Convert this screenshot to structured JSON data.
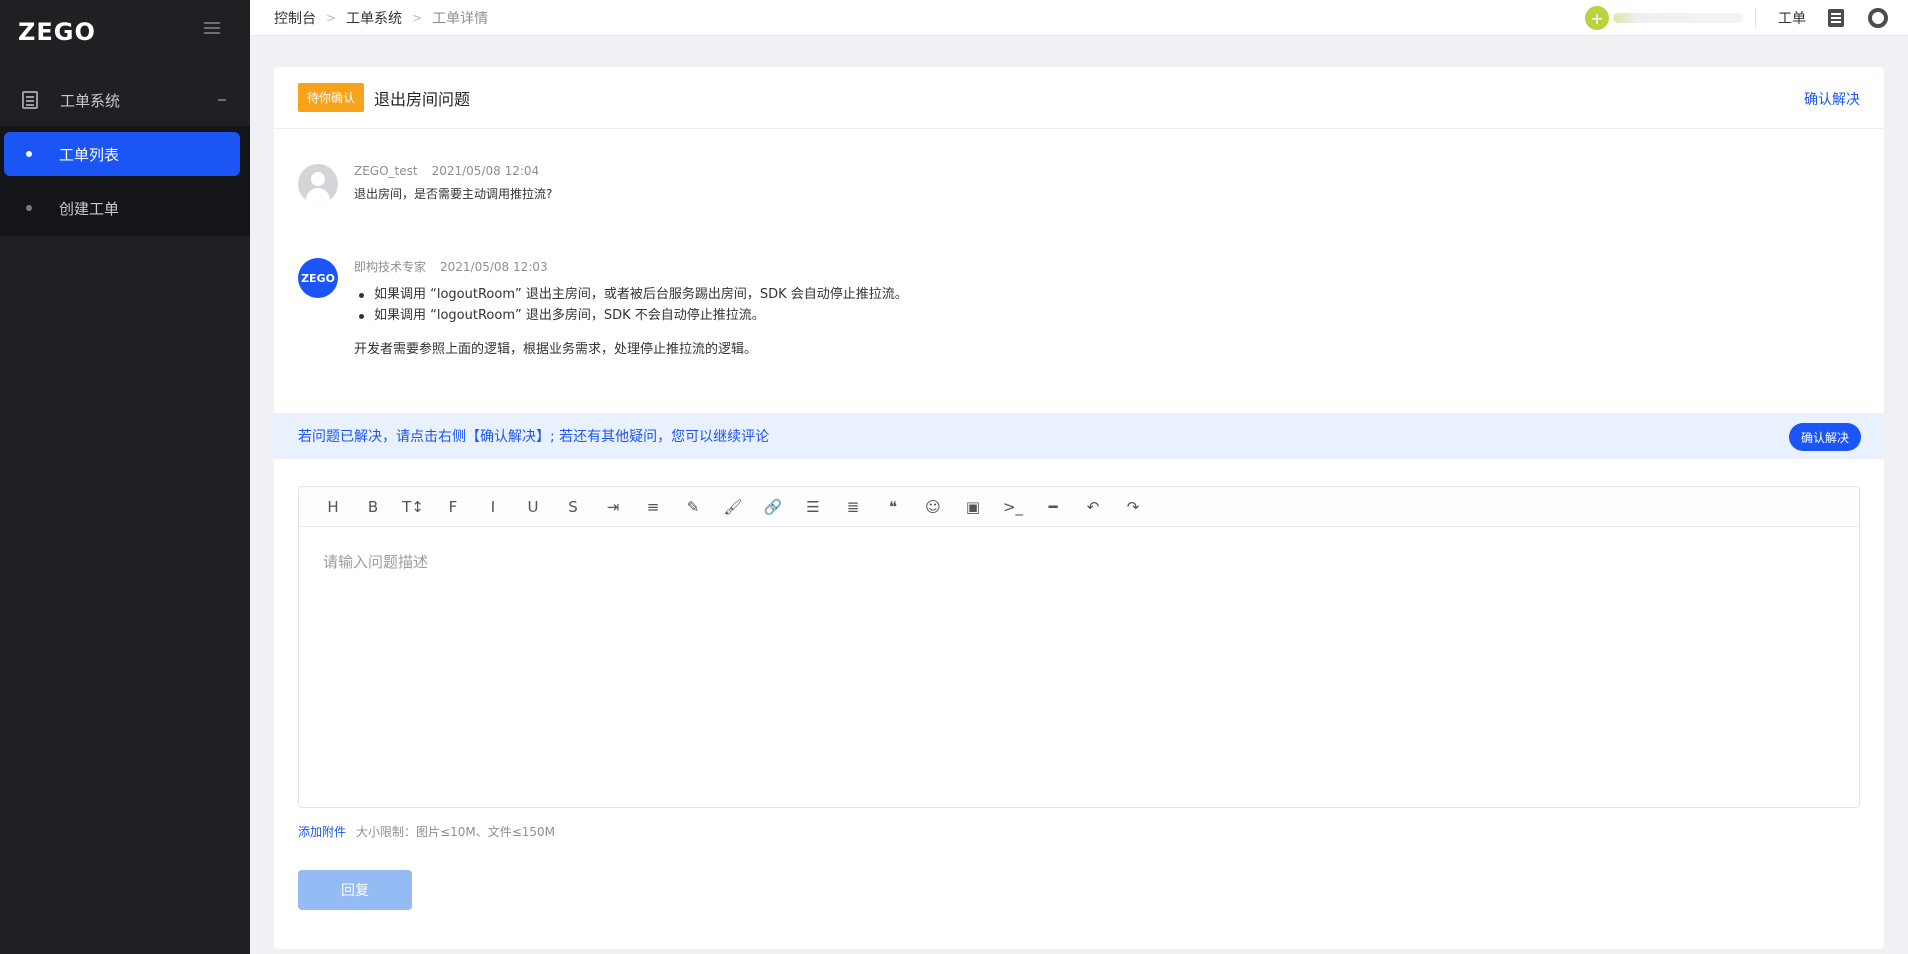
{
  "sidebar": {
    "logo": "ZEGO",
    "group_label": "工单系统",
    "items": [
      {
        "label": "工单列表",
        "active": true
      },
      {
        "label": "创建工单",
        "active": false
      }
    ]
  },
  "topbar": {
    "breadcrumbs": [
      "控制台",
      "工单系统",
      "工单详情"
    ],
    "link_ticket": "工单",
    "avatar_glyph": "+"
  },
  "ticket": {
    "status_badge": "待你确认",
    "title": "退出房间问题",
    "confirm_link": "确认解决"
  },
  "messages": [
    {
      "author": "ZEGO_test",
      "time": "2021/05/08 12:04",
      "text": "退出房间，是否需要主动调用推拉流?"
    },
    {
      "author": "即构技术专家",
      "avatar_text": "ZEGO",
      "time": "2021/05/08 12:03",
      "bullets": [
        "如果调用 “logoutRoom” 退出主房间，或者被后台服务踢出房间，SDK 会自动停止推拉流。",
        "如果调用 “logoutRoom” 退出多房间，SDK 不会自动停止推拉流。"
      ],
      "after": "开发者需要参照上面的逻辑，根据业务需求，处理停止推拉流的逻辑。"
    }
  ],
  "tip": {
    "text": "若问题已解决，请点击右侧【确认解决】; 若还有其他疑问，您可以继续评论",
    "button": "确认解决"
  },
  "editor": {
    "toolbar": [
      {
        "name": "heading-icon",
        "glyph": "H"
      },
      {
        "name": "bold-icon",
        "glyph": "B"
      },
      {
        "name": "font-size-icon",
        "glyph": "T↕"
      },
      {
        "name": "font-family-icon",
        "glyph": "F"
      },
      {
        "name": "italic-icon",
        "glyph": "I"
      },
      {
        "name": "underline-icon",
        "glyph": "U"
      },
      {
        "name": "strikethrough-icon",
        "glyph": "S"
      },
      {
        "name": "indent-icon",
        "glyph": "⇥"
      },
      {
        "name": "line-height-icon",
        "glyph": "≡"
      },
      {
        "name": "font-color-icon",
        "glyph": "✎"
      },
      {
        "name": "background-color-icon",
        "glyph": "🖌"
      },
      {
        "name": "link-icon",
        "glyph": "🔗"
      },
      {
        "name": "list-icon",
        "glyph": "☰"
      },
      {
        "name": "align-icon",
        "glyph": "≣"
      },
      {
        "name": "quote-icon",
        "glyph": "❝"
      },
      {
        "name": "emoji-icon",
        "glyph": "☺"
      },
      {
        "name": "image-icon",
        "glyph": "▣"
      },
      {
        "name": "code-icon",
        "glyph": ">_"
      },
      {
        "name": "divider-icon",
        "glyph": "━"
      },
      {
        "name": "undo-icon",
        "glyph": "↶"
      },
      {
        "name": "redo-icon",
        "glyph": "↷"
      }
    ],
    "placeholder": "请输入问题描述"
  },
  "attachment": {
    "link": "添加附件",
    "hint": "大小限制：图片≤10M、文件≤150M"
  },
  "reply_button": "回复"
}
